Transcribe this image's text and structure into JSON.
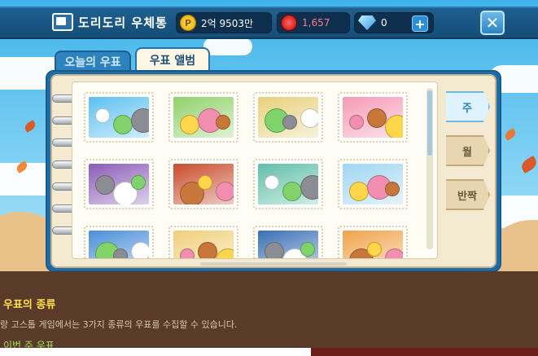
{
  "header": {
    "title": "도리도리 우체통",
    "coins": "2억 9503만",
    "gems": "1,657",
    "diamonds": "0",
    "plus_label": "+",
    "close_label": "✕"
  },
  "tabs": [
    {
      "label": "오늘의 우표",
      "active": false
    },
    {
      "label": "우표 앨범",
      "active": true
    }
  ],
  "side_tabs": [
    {
      "label": "주",
      "active": true
    },
    {
      "label": "월",
      "active": false
    },
    {
      "label": "반짝",
      "active": false
    }
  ],
  "stamps": [
    {
      "theme": "gray-raccoon-blue",
      "bg": "#5cc0f0"
    },
    {
      "theme": "pink-bird-meadow",
      "bg": "#8fd16a"
    },
    {
      "theme": "group-dogs-garden",
      "bg": "#e7d07b"
    },
    {
      "theme": "green-duck-pink",
      "bg": "#f59ab5"
    },
    {
      "theme": "cowboy-purple",
      "bg": "#8a5cb8"
    },
    {
      "theme": "boar-red",
      "bg": "#c94a2a"
    },
    {
      "theme": "green-duck-car",
      "bg": "#5fbfa8"
    },
    {
      "theme": "raccoon-winter",
      "bg": "#9fd6f2"
    },
    {
      "theme": "fox-blue",
      "bg": "#4a8ed8"
    },
    {
      "theme": "gold-dragon",
      "bg": "#f0cf78"
    },
    {
      "theme": "deer-crowd",
      "bg": "#3b6fb5"
    },
    {
      "theme": "duck-autumn",
      "bg": "#f0a34a"
    }
  ],
  "info": {
    "title": "우표의 종류",
    "description": "랑 고스톱 게임에서는 3가지 종류의 우표를 수집할 수 있습니다.",
    "link": "이번 주 우표"
  }
}
